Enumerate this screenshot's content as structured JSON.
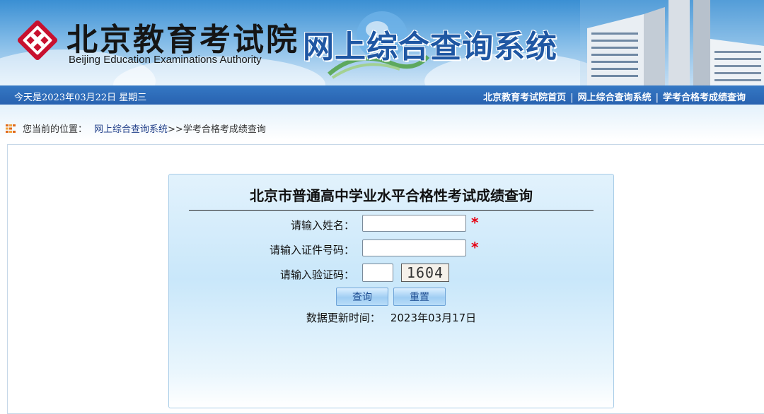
{
  "header": {
    "org_name_cn": "北京教育考试院",
    "org_name_en": "Beijing Education Examinations Authority",
    "system_title": "网上综合查询系统",
    "brand_color": "#c8102e"
  },
  "navbar": {
    "date_text": "今天是2023年03月22日  星期三",
    "links": [
      "北京教育考试院首页",
      "网上综合查询系统",
      "学考合格考成绩查询"
    ],
    "separator": "|"
  },
  "breadcrumb": {
    "prefix": "您当前的位置：",
    "link": "网上综合查询系统",
    "current": ">>学考合格考成绩查询"
  },
  "form": {
    "title": "北京市普通高中学业水平合格性考试成绩查询",
    "name_label": "请输入姓名：",
    "name_value": "",
    "id_label": "请输入证件号码：",
    "id_value": "",
    "captcha_label": "请输入验证码：",
    "captcha_value": "",
    "captcha_text": "1604",
    "required_mark": "*",
    "query_button": "查询",
    "reset_button": "重置",
    "update_label": "数据更新时间：",
    "update_value": "2023年03月17日"
  }
}
